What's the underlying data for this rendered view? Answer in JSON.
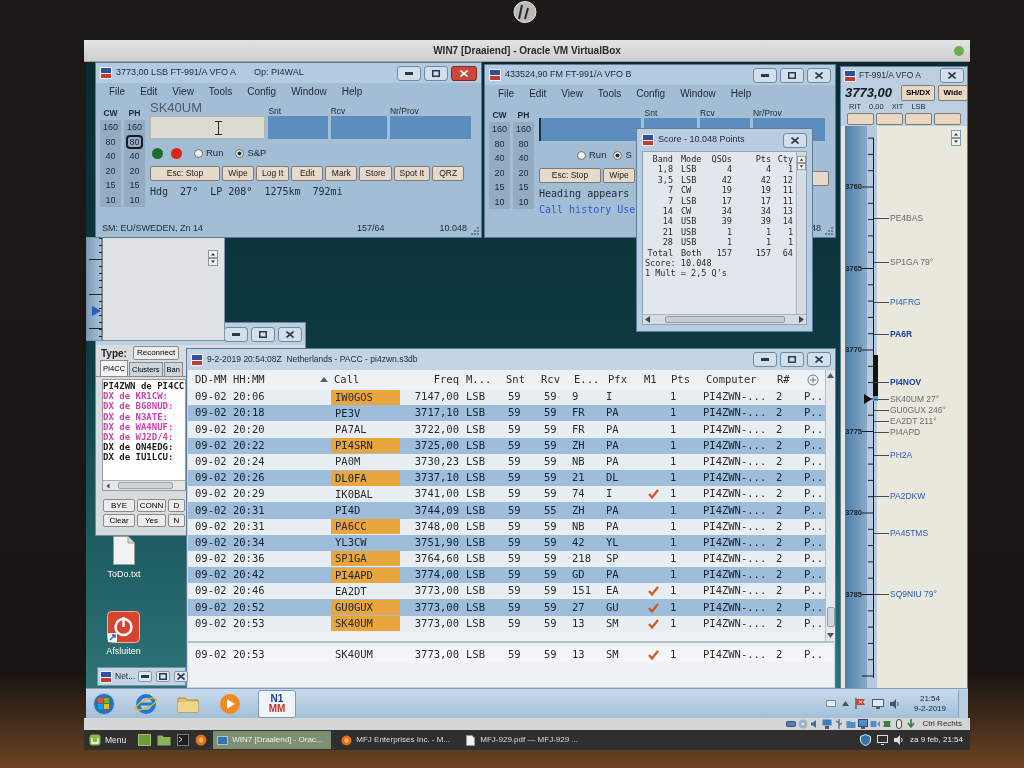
{
  "host": {
    "vm_title": "WIN7 [Draaiend] - Oracle VM VirtualBox",
    "host_key": "Ctrl Rechts"
  },
  "entry_windows": [
    {
      "active": true,
      "title": "3773,00 LSB FT-991/A VFO A",
      "operator": "Op: PI4WAL",
      "menu": [
        "File",
        "Edit",
        "View",
        "Tools",
        "Config",
        "Window",
        "Help"
      ],
      "band_columns": [
        {
          "header": "CW",
          "bands": [
            {
              "label": "160",
              "selected": false
            },
            {
              "label": "80",
              "selected": false
            },
            {
              "label": "40",
              "selected": false
            },
            {
              "label": "20",
              "selected": false
            },
            {
              "label": "15",
              "selected": false
            },
            {
              "label": "10",
              "selected": false
            }
          ]
        },
        {
          "header": "PH",
          "bands": [
            {
              "label": "160",
              "selected": false
            },
            {
              "label": "80",
              "selected": true
            },
            {
              "label": "40",
              "selected": false
            },
            {
              "label": "20",
              "selected": false
            },
            {
              "label": "15",
              "selected": false
            },
            {
              "label": "10",
              "selected": false
            }
          ]
        }
      ],
      "call_label": "SK40UM",
      "fields": [
        "Snt",
        "Rcv",
        "Nr/Prov"
      ],
      "indicators": [
        {
          "color": "#1f6b2c"
        },
        {
          "color": "#e0231b"
        }
      ],
      "modes": [
        {
          "label": "Run",
          "selected": false
        },
        {
          "label": "S&P",
          "selected": true
        }
      ],
      "buttons": [
        "Esc: Stop",
        "Wipe",
        "Log It",
        "Edit",
        "Mark",
        "Store",
        "Spot It",
        "QRZ"
      ],
      "info_lines": [
        {
          "text": "Hdg  27°  LP 208°  1275km  792mi",
          "color": "#1c2a38"
        }
      ],
      "status": [
        "SM: EU/SWEDEN, Zn 14",
        "157/64",
        "10.048"
      ]
    },
    {
      "active": false,
      "title": "433524,90 FM FT-991/A VFO B",
      "menu": [
        "File",
        "Edit",
        "View",
        "Tools",
        "Config",
        "Window",
        "Help"
      ],
      "band_columns": [
        {
          "header": "CW",
          "bands": [
            {
              "label": "160",
              "selected": false
            },
            {
              "label": "80",
              "selected": false
            },
            {
              "label": "40",
              "selected": false
            },
            {
              "label": "20",
              "selected": false
            },
            {
              "label": "15",
              "selected": false
            },
            {
              "label": "10",
              "selected": false
            }
          ]
        },
        {
          "header": "PH",
          "bands": [
            {
              "label": "160",
              "selected": false
            },
            {
              "label": "80",
              "selected": false
            },
            {
              "label": "40",
              "selected": false
            },
            {
              "label": "20",
              "selected": false
            },
            {
              "label": "15",
              "selected": false
            },
            {
              "label": "10",
              "selected": false
            }
          ]
        }
      ],
      "fields": [
        "Snt",
        "Rcv",
        "Nr/Prov"
      ],
      "modes": [
        {
          "label": "Run",
          "selected": false
        },
        {
          "label": "S",
          "selected": true
        }
      ],
      "buttons": [
        "Esc: Stop",
        "Wipe"
      ],
      "info_lines": [
        {
          "text": "Heading appears",
          "color": "#1c2a38"
        },
        {
          "text": "Call history Use",
          "color": "#2c5bd0"
        }
      ],
      "status": [
        "48"
      ]
    }
  ],
  "score": {
    "title": "Score - 10.048 Points",
    "columns": [
      "Band",
      "Mode",
      "QSOs",
      "Pts",
      "Cty"
    ],
    "rows": [
      [
        "1,8",
        "LSB",
        "4",
        "4",
        "1"
      ],
      [
        "3,5",
        "LSB",
        "42",
        "42",
        "12"
      ],
      [
        "7",
        "CW",
        "19",
        "19",
        "11"
      ],
      [
        "7",
        "LSB",
        "17",
        "17",
        "11"
      ],
      [
        "14",
        "CW",
        "34",
        "34",
        "13"
      ],
      [
        "14",
        "USB",
        "39",
        "39",
        "14"
      ],
      [
        "21",
        "USB",
        "1",
        "1",
        "1"
      ],
      [
        "28",
        "USB",
        "1",
        "1",
        "1"
      ],
      [
        "Total",
        "Both",
        "157",
        "157",
        "64"
      ]
    ],
    "summary": [
      "Score: 10.048",
      "1 Mult = 2,5 Q's"
    ]
  },
  "bandmap": {
    "title": "FT-991/A VFO A",
    "frequency": "3773,00",
    "buttons": [
      "SH/DX",
      "Wide"
    ],
    "rig_status": [
      "RIT",
      "0,00",
      "XIT",
      "LSB"
    ],
    "scale_labels": [
      "3760",
      "3765",
      "3770",
      "3775",
      "3780",
      "3785"
    ],
    "spots": [
      {
        "label": "PE4BAS",
        "kind": "dupe"
      },
      {
        "label": "SP1GA 79°",
        "kind": "dupe"
      },
      {
        "label": "PI4FRG",
        "kind": "new"
      },
      {
        "label": "PA6R",
        "kind": "mult"
      },
      {
        "label": "PI4NOV",
        "kind": "mult"
      },
      {
        "label": "SK40UM 27°",
        "kind": "dupe"
      },
      {
        "label": "GU0GUX 246°",
        "kind": "dupe"
      },
      {
        "label": "EA2DT 211°",
        "kind": "dupe"
      },
      {
        "label": "PI4APD",
        "kind": "dupe"
      },
      {
        "label": "PH2A",
        "kind": "new"
      },
      {
        "label": "PA2DKW",
        "kind": "new"
      },
      {
        "label": "PA45TMS",
        "kind": "new"
      },
      {
        "label": "SQ9NIU 79°",
        "kind": "new"
      }
    ]
  },
  "telnet": {
    "type_label": "Type:",
    "reconnect": "Reconnect",
    "tabs": [
      {
        "label": "PI4CC",
        "selected": true
      },
      {
        "label": "Clusters",
        "selected": false
      },
      {
        "label": "Ban",
        "selected": false
      }
    ],
    "lines": [
      {
        "text": "PI4ZWN de PI4CC",
        "color": "#1e1e1e"
      },
      {
        "text": "DX de KR1CW:",
        "color": "#d23fae"
      },
      {
        "text": "DX de BG8NUD:",
        "color": "#d23fae"
      },
      {
        "text": "DX de N3ATE:",
        "color": "#d23fae"
      },
      {
        "text": "DX de WA4NUF:",
        "color": "#d23fae"
      },
      {
        "text": "DX de WJ2D/4:",
        "color": "#d23fae"
      },
      {
        "text": "DX de ON4EDG:",
        "color": "#1e1e1e"
      },
      {
        "text": "DX de IU1LCU:",
        "color": "#1e1e1e"
      }
    ],
    "buttons": [
      "BYE",
      "CONN",
      "D",
      "Clear",
      "Yes",
      "N"
    ]
  },
  "log": {
    "title": "9-2-2019 20:54:08Z  Netherlands - PACC - pi4zwn.s3db",
    "columns": [
      {
        "label": "DD-MM HH:MM",
        "sorted": false
      },
      {
        "label": "Call",
        "sorted": true
      },
      {
        "label": "Freq",
        "sorted": false
      },
      {
        "label": "M...",
        "sorted": false
      },
      {
        "label": "Snt",
        "sorted": false
      },
      {
        "label": "Rcv",
        "sorted": false
      },
      {
        "label": "E...",
        "sorted": false
      },
      {
        "label": "Pfx",
        "sorted": false
      },
      {
        "label": "M1",
        "sorted": false
      },
      {
        "label": "Pts",
        "sorted": false
      },
      {
        "label": "Computer",
        "sorted": false
      },
      {
        "label": "R#",
        "sorted": false
      }
    ],
    "rows": [
      {
        "cells": [
          "09-02 20:06",
          "IW0GOS",
          "7147,00",
          "LSB",
          "59",
          "59",
          "9",
          "I",
          "",
          "1",
          "PI4ZWN-...",
          "2",
          "P.."
        ],
        "highlight": true,
        "m1": false
      },
      {
        "cells": [
          "09-02 20:18",
          "PE3V",
          "3717,10",
          "LSB",
          "59",
          "59",
          "FR",
          "PA",
          "",
          "1",
          "PI4ZWN-...",
          "2",
          "P.."
        ],
        "highlight": false,
        "m1": false
      },
      {
        "cells": [
          "09-02 20:20",
          "PA7AL",
          "3722,00",
          "LSB",
          "59",
          "59",
          "FR",
          "PA",
          "",
          "1",
          "PI4ZWN-...",
          "2",
          "P.."
        ],
        "highlight": false,
        "m1": false
      },
      {
        "cells": [
          "09-02 20:22",
          "PI4SRN",
          "3725,00",
          "LSB",
          "59",
          "59",
          "ZH",
          "PA",
          "",
          "1",
          "PI4ZWN-...",
          "2",
          "P.."
        ],
        "highlight": true,
        "m1": false
      },
      {
        "cells": [
          "09-02 20:24",
          "PA0M",
          "3730,23",
          "LSB",
          "59",
          "59",
          "NB",
          "PA",
          "",
          "1",
          "PI4ZWN-...",
          "2",
          "P.."
        ],
        "highlight": false,
        "m1": false
      },
      {
        "cells": [
          "09-02 20:26",
          "DL0FA",
          "3737,10",
          "LSB",
          "59",
          "59",
          "21",
          "DL",
          "",
          "1",
          "PI4ZWN-...",
          "2",
          "P.."
        ],
        "highlight": true,
        "m1": false
      },
      {
        "cells": [
          "09-02 20:29",
          "IK0BAL",
          "3741,00",
          "LSB",
          "59",
          "59",
          "74",
          "I",
          "",
          "1",
          "PI4ZWN-...",
          "2",
          "P.."
        ],
        "highlight": false,
        "m1": true
      },
      {
        "cells": [
          "09-02 20:31",
          "PI4D",
          "3744,09",
          "LSB",
          "59",
          "55",
          "ZH",
          "PA",
          "",
          "1",
          "PI4ZWN-...",
          "2",
          "P.."
        ],
        "highlight": false,
        "m1": false
      },
      {
        "cells": [
          "09-02 20:31",
          "PA6CC",
          "3748,00",
          "LSB",
          "59",
          "59",
          "NB",
          "PA",
          "",
          "1",
          "PI4ZWN-...",
          "2",
          "P.."
        ],
        "highlight": true,
        "m1": false
      },
      {
        "cells": [
          "09-02 20:34",
          "YL3CW",
          "3751,90",
          "LSB",
          "59",
          "59",
          "42",
          "YL",
          "",
          "1",
          "PI4ZWN-...",
          "2",
          "P.."
        ],
        "highlight": false,
        "m1": false
      },
      {
        "cells": [
          "09-02 20:36",
          "SP1GA",
          "3764,60",
          "LSB",
          "59",
          "59",
          "218",
          "SP",
          "",
          "1",
          "PI4ZWN-...",
          "2",
          "P.."
        ],
        "highlight": true,
        "m1": false
      },
      {
        "cells": [
          "09-02 20:42",
          "PI4APD",
          "3774,00",
          "LSB",
          "59",
          "59",
          "GD",
          "PA",
          "",
          "1",
          "PI4ZWN-...",
          "2",
          "P.."
        ],
        "highlight": true,
        "m1": false
      },
      {
        "cells": [
          "09-02 20:46",
          "EA2DT",
          "3773,00",
          "LSB",
          "59",
          "59",
          "151",
          "EA",
          "",
          "1",
          "PI4ZWN-...",
          "2",
          "P.."
        ],
        "highlight": false,
        "m1": true
      },
      {
        "cells": [
          "09-02 20:52",
          "GU0GUX",
          "3773,00",
          "LSB",
          "59",
          "59",
          "27",
          "GU",
          "",
          "1",
          "PI4ZWN-...",
          "2",
          "P.."
        ],
        "highlight": true,
        "m1": true
      },
      {
        "cells": [
          "09-02 20:53",
          "SK40UM",
          "3773,00",
          "LSB",
          "59",
          "59",
          "13",
          "SM",
          "",
          "1",
          "PI4ZWN-...",
          "2",
          "P.."
        ],
        "highlight": true,
        "m1": true
      }
    ],
    "entry_row": {
      "cells": [
        "09-02 20:53",
        "SK40UM",
        "3773,00",
        "LSB",
        "59",
        "59",
        "13",
        "SM",
        "",
        "1",
        "PI4ZWN-...",
        "2",
        "P.."
      ],
      "m1": true
    }
  },
  "desktop_icons": [
    {
      "label": "ToDo.txt",
      "kind": "document"
    },
    {
      "label": "Afsluiten",
      "kind": "shutdown"
    }
  ],
  "minimized": {
    "label": "Net..."
  },
  "taskbar": {
    "apps": [
      {
        "kind": "start",
        "selected": false
      },
      {
        "kind": "browser",
        "selected": false
      },
      {
        "kind": "folder",
        "selected": false
      },
      {
        "kind": "media",
        "selected": false
      },
      {
        "kind": "n1mm",
        "selected": true,
        "text": [
          "N1",
          "MM"
        ]
      }
    ],
    "time": "21:54",
    "date": "9-2-2019"
  },
  "panel": {
    "menu": "Menu",
    "tasks": [
      {
        "label": "WIN7 [Draaiend] - Orac...",
        "kind": "vbox",
        "selected": true
      },
      {
        "label": "MFJ Enterprises Inc. - M...",
        "kind": "browser",
        "selected": false
      },
      {
        "label": "MFJ-929.pdf — MFJ-929 ...",
        "kind": "pdf",
        "selected": false
      }
    ],
    "clock": "za 9 feb, 21:54"
  }
}
